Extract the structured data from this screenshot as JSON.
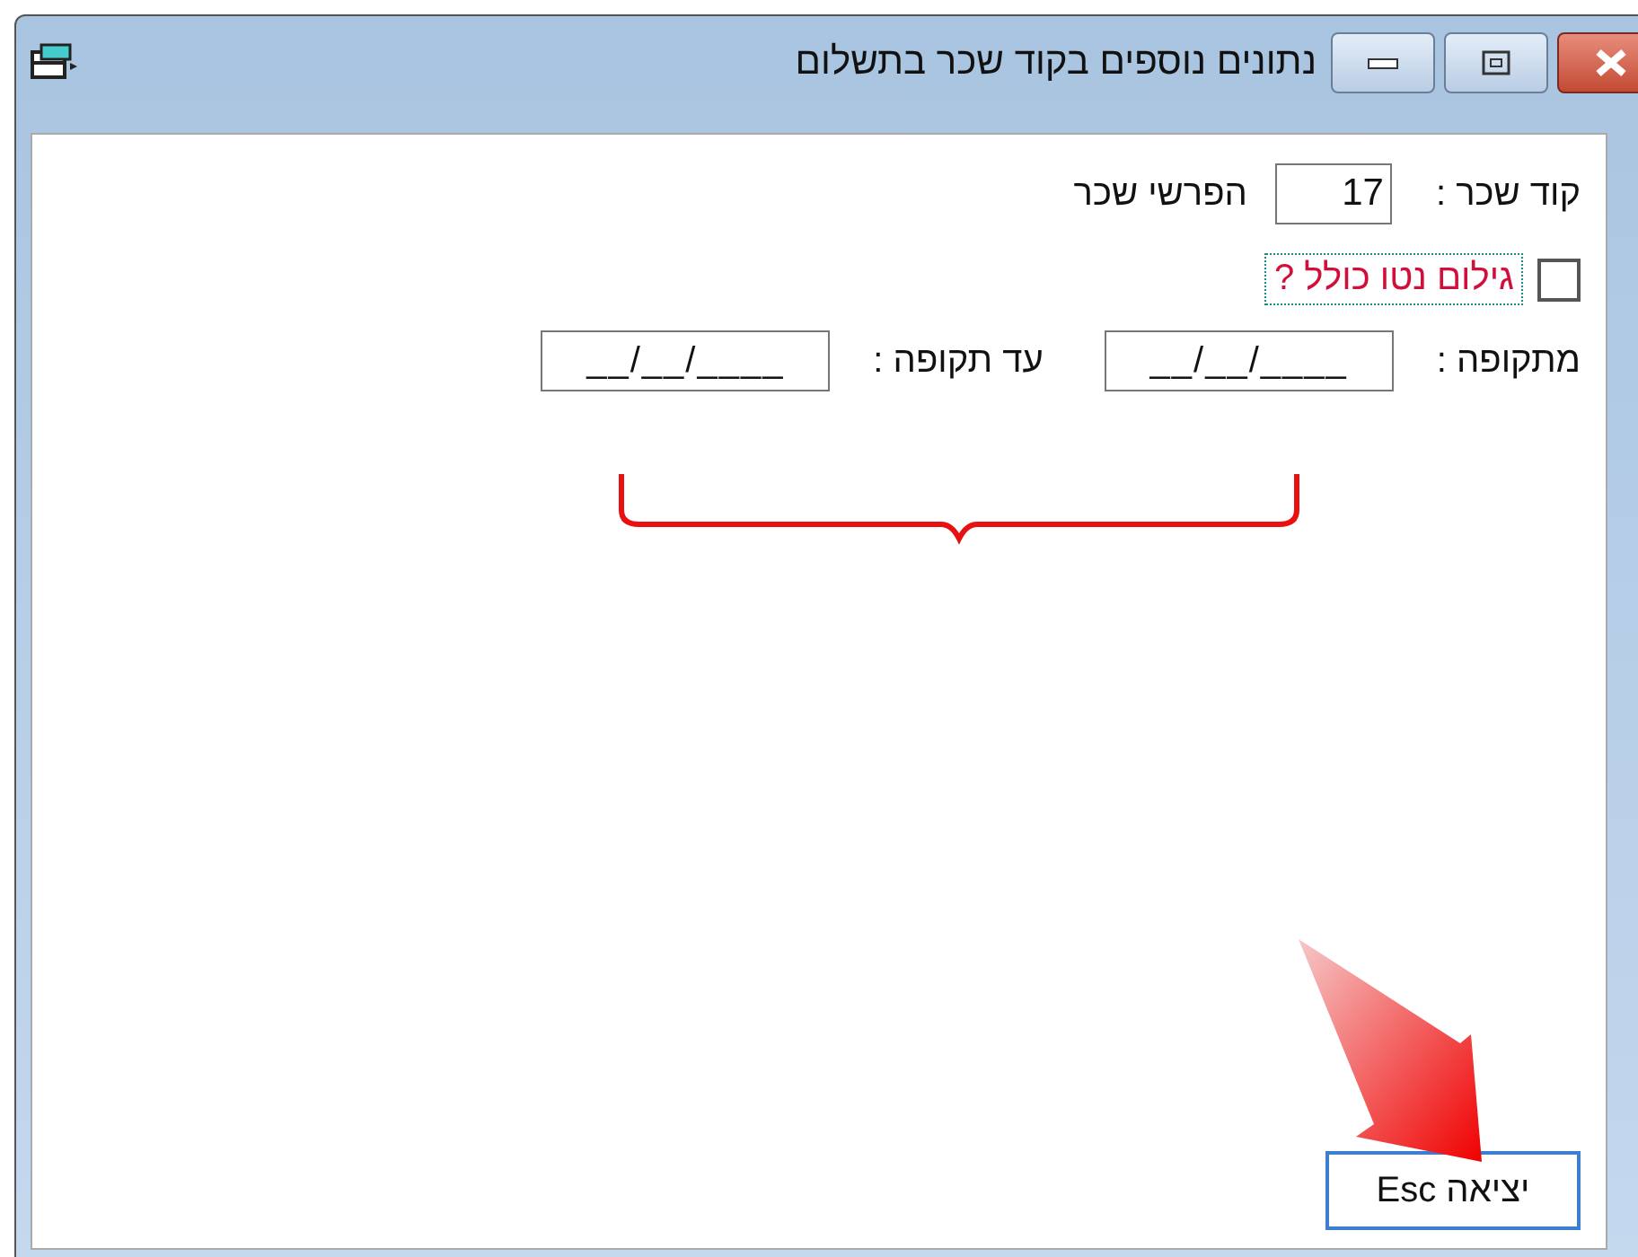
{
  "window": {
    "title": "נתונים נוספים בקוד שכר בתשלום",
    "buttons": [
      {
        "kind": "minimize"
      },
      {
        "kind": "maximize"
      },
      {
        "kind": "close"
      }
    ]
  },
  "salary_code": {
    "label": "קוד שכר :",
    "value": "17",
    "description": "הפרשי שכר"
  },
  "gross_up": {
    "label": "גילום נטו כולל ?",
    "checked": false,
    "focused": true
  },
  "period": {
    "from_label": "מתקופה :",
    "from_value": "__/__/____",
    "to_label": "עד תקופה :",
    "to_value": "__/__/____"
  },
  "exit_button": {
    "label": "יציאה Esc"
  }
}
